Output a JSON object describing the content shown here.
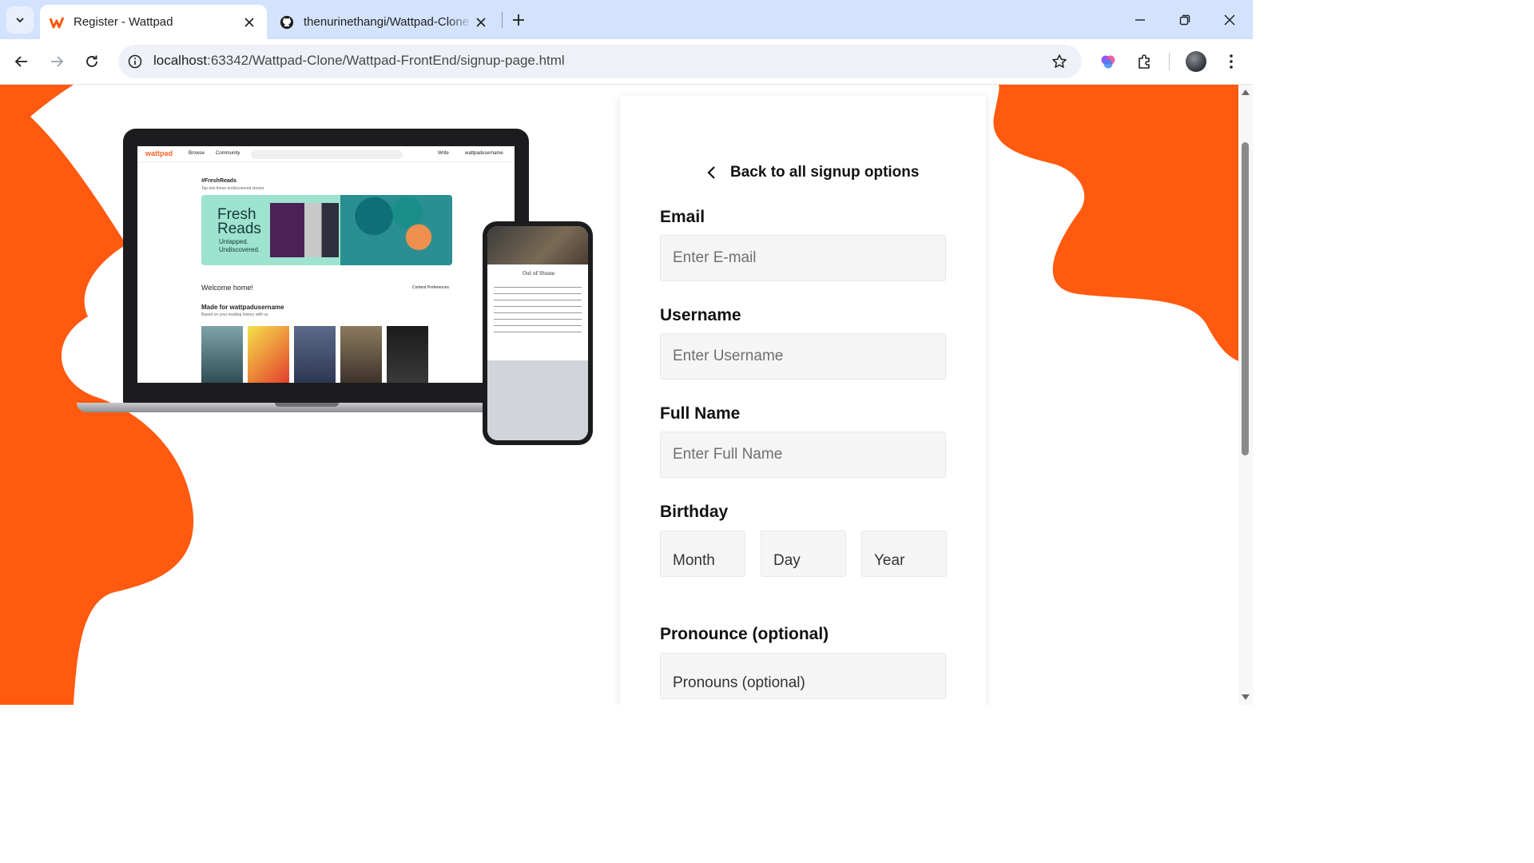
{
  "browser": {
    "tabs": [
      {
        "title": "Register - Wattpad",
        "active": true,
        "icon": "wattpad-icon"
      },
      {
        "title": "thenurinethangi/Wattpad-Clone",
        "active": false,
        "icon": "github-icon"
      }
    ],
    "url": {
      "host": "localhost",
      "rest": ":63342/Wattpad-Clone/Wattpad-FrontEnd/signup-page.html"
    }
  },
  "colors": {
    "brand": "#ff5a0f",
    "input_bg": "#f5f5f6"
  },
  "mockup": {
    "brand": "wattpad",
    "browse": "Browse",
    "community": "Community",
    "write": "Write",
    "username": "wattpadusername",
    "fresh_reads_tag": "#FreshReads",
    "fresh_reads_sub": "Tap into these undiscovered stories",
    "banner_title": "Fresh Reads",
    "banner_sub": "Untapped. Undiscovered.",
    "welcome": "Welcome home!",
    "content_prefs": "Content Preferences",
    "made_for": "Made for wattpadusername",
    "made_for_sub": "Based on your reading history with us",
    "phone_title": "Out of Steam"
  },
  "signup": {
    "back_label": "Back to all signup options",
    "email": {
      "label": "Email",
      "placeholder": "Enter E-mail"
    },
    "username": {
      "label": "Username",
      "placeholder": "Enter Username"
    },
    "fullname": {
      "label": "Full Name",
      "placeholder": "Enter Full Name"
    },
    "birthday": {
      "label": "Birthday",
      "month": "Month",
      "day": "Day",
      "year": "Year"
    },
    "pronoun": {
      "label": "Pronounce (optional)",
      "placeholder": "Pronouns (optional)"
    }
  }
}
